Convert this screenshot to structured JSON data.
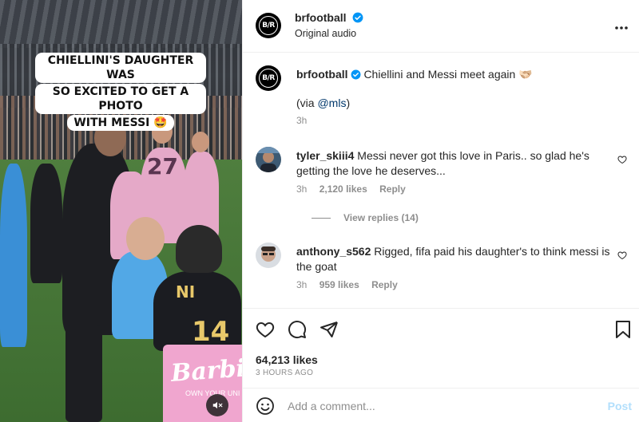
{
  "media": {
    "caption_lines": [
      "CHIELLINI'S DAUGHTER WAS",
      "SO EXCITED TO GET A PHOTO",
      "WITH MESSI 🤩"
    ],
    "jersey_numbers": [
      "27",
      "14"
    ],
    "jersey_name": "NI",
    "barbie_text": "Barbie",
    "barbie_sub": "OWN YOUR UNI",
    "mute_icon": "speaker-muted-icon"
  },
  "header": {
    "username": "brfootball",
    "subtitle": "Original audio",
    "avatar_logo": "B/R",
    "more_icon": "more-horizontal-icon"
  },
  "caption": {
    "username": "brfootball",
    "text": "Chiellini and Messi meet again 🫱🏻‍🫲🏼",
    "via_prefix": "(via ",
    "via_handle": "@mls",
    "via_suffix": ")",
    "time": "3h"
  },
  "comments": [
    {
      "username": "tyler_skiii4",
      "text": "Messi never got this love in Paris.. so glad he's getting the love he deserves...",
      "time": "3h",
      "likes": "2,120 likes",
      "reply": "Reply",
      "view_replies": "View replies (14)"
    },
    {
      "username": "anthony_s562",
      "text": "Rigged, fifa paid his daughter's to think messi is the goat",
      "time": "3h",
      "likes": "959 likes",
      "reply": "Reply"
    }
  ],
  "actions": {
    "likes": "64,213 likes",
    "posted": "3 HOURS AGO"
  },
  "add_comment": {
    "placeholder": "Add a comment...",
    "post_label": "Post"
  },
  "colors": {
    "verified": "#0095f6",
    "post_disabled": "#b2dffc",
    "secondary_text": "#8e8e8e"
  }
}
